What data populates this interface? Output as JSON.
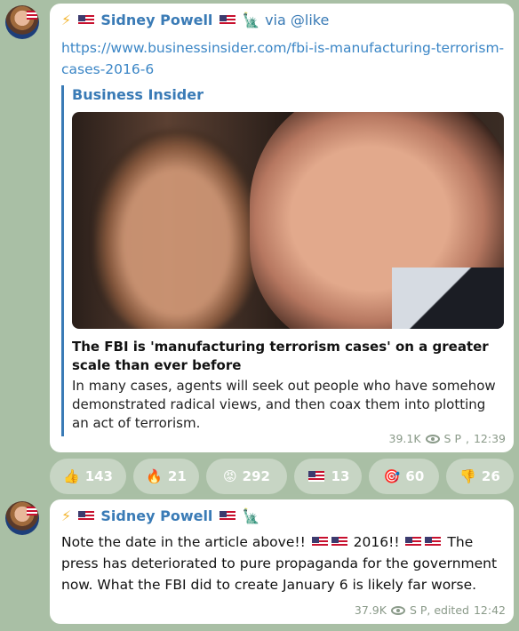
{
  "post1": {
    "sender_prefix": "⚡",
    "sender_name": "Sidney Powell",
    "via_text": "via @like",
    "link": "https://www.businessinsider.com/fbi-is-manufacturing-terrorism-cases-2016-6",
    "preview_site": "Business Insider",
    "preview_title": "The FBI is 'manufacturing terrorism cases' on a greater scale than ever before",
    "preview_desc": "In many cases, agents will seek out people who have somehow demonstrated radical views, and then coax them into plotting an act of terrorism.",
    "views": "39.1K",
    "author": "S P",
    "time": "12:39"
  },
  "reactions": [
    {
      "emoji": "👍",
      "count": "143"
    },
    {
      "emoji": "🔥",
      "count": "21"
    },
    {
      "emoji": "😡",
      "count": "292"
    },
    {
      "emoji": "🇺🇸",
      "count": "13"
    },
    {
      "emoji": "🎯",
      "count": "60"
    },
    {
      "emoji": "👎",
      "count": "26"
    }
  ],
  "post2": {
    "sender_prefix": "⚡",
    "sender_name": "Sidney Powell",
    "text_part1": "Note the date in the article above!!",
    "text_part2": "2016!!",
    "text_part3": "The press has deteriorated to pure propaganda for the government now. What the FBI did to create January 6 is likely far worse.",
    "views": "37.9K",
    "author": "S P, edited",
    "time": "12:42"
  },
  "colors": {
    "background": "#a9bfa5",
    "accent": "#3a7bb6",
    "bubble": "#ffffff"
  }
}
